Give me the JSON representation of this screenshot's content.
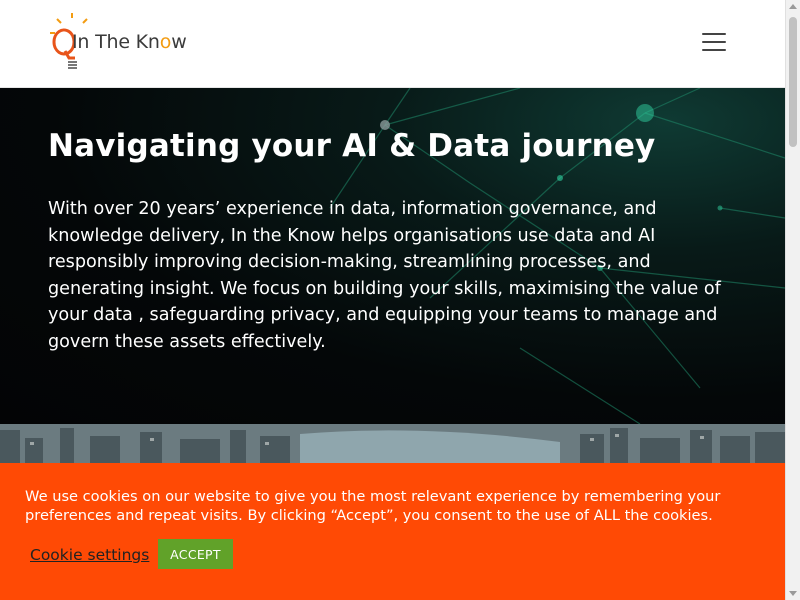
{
  "header": {
    "logo_text_pre": "In The Kn",
    "logo_text_o": "o",
    "logo_text_post": "w",
    "menu_icon": "hamburger-menu-icon"
  },
  "hero": {
    "title": "Navigating your AI & Data journey",
    "body": "With over 20 years’ experience in data, information governance, and knowledge delivery, In the Know helps organisations use data and AI responsibly improving decision-making, streamlining processes, and generating insight. We focus on building your skills, maximising the value of your data , safeguarding privacy, and equipping your teams to manage and govern these assets effectively."
  },
  "cookie_banner": {
    "message": "We use cookies on our website to give you the most relevant experience by remembering your preferences and repeat visits. By clicking “Accept”, you consent to the use of ALL the cookies.",
    "settings_label": "Cookie settings",
    "accept_label": "ACCEPT"
  },
  "colors": {
    "cookie_bg": "#ff4a05",
    "accept_bg": "#61a229",
    "logo_accent": "#f39c12"
  }
}
